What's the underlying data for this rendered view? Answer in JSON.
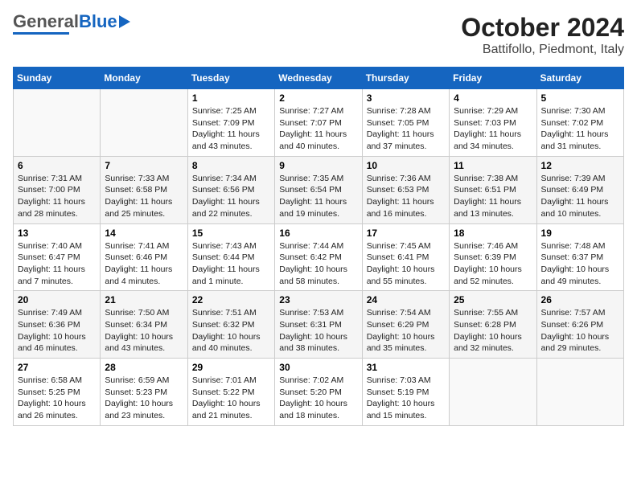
{
  "logo": {
    "text_general": "General",
    "text_blue": "Blue"
  },
  "title": "October 2024",
  "subtitle": "Battifollo, Piedmont, Italy",
  "header_row": [
    "Sunday",
    "Monday",
    "Tuesday",
    "Wednesday",
    "Thursday",
    "Friday",
    "Saturday"
  ],
  "weeks": [
    [
      {
        "day": "",
        "info": ""
      },
      {
        "day": "",
        "info": ""
      },
      {
        "day": "1",
        "info": "Sunrise: 7:25 AM\nSunset: 7:09 PM\nDaylight: 11 hours\nand 43 minutes."
      },
      {
        "day": "2",
        "info": "Sunrise: 7:27 AM\nSunset: 7:07 PM\nDaylight: 11 hours\nand 40 minutes."
      },
      {
        "day": "3",
        "info": "Sunrise: 7:28 AM\nSunset: 7:05 PM\nDaylight: 11 hours\nand 37 minutes."
      },
      {
        "day": "4",
        "info": "Sunrise: 7:29 AM\nSunset: 7:03 PM\nDaylight: 11 hours\nand 34 minutes."
      },
      {
        "day": "5",
        "info": "Sunrise: 7:30 AM\nSunset: 7:02 PM\nDaylight: 11 hours\nand 31 minutes."
      }
    ],
    [
      {
        "day": "6",
        "info": "Sunrise: 7:31 AM\nSunset: 7:00 PM\nDaylight: 11 hours\nand 28 minutes."
      },
      {
        "day": "7",
        "info": "Sunrise: 7:33 AM\nSunset: 6:58 PM\nDaylight: 11 hours\nand 25 minutes."
      },
      {
        "day": "8",
        "info": "Sunrise: 7:34 AM\nSunset: 6:56 PM\nDaylight: 11 hours\nand 22 minutes."
      },
      {
        "day": "9",
        "info": "Sunrise: 7:35 AM\nSunset: 6:54 PM\nDaylight: 11 hours\nand 19 minutes."
      },
      {
        "day": "10",
        "info": "Sunrise: 7:36 AM\nSunset: 6:53 PM\nDaylight: 11 hours\nand 16 minutes."
      },
      {
        "day": "11",
        "info": "Sunrise: 7:38 AM\nSunset: 6:51 PM\nDaylight: 11 hours\nand 13 minutes."
      },
      {
        "day": "12",
        "info": "Sunrise: 7:39 AM\nSunset: 6:49 PM\nDaylight: 11 hours\nand 10 minutes."
      }
    ],
    [
      {
        "day": "13",
        "info": "Sunrise: 7:40 AM\nSunset: 6:47 PM\nDaylight: 11 hours\nand 7 minutes."
      },
      {
        "day": "14",
        "info": "Sunrise: 7:41 AM\nSunset: 6:46 PM\nDaylight: 11 hours\nand 4 minutes."
      },
      {
        "day": "15",
        "info": "Sunrise: 7:43 AM\nSunset: 6:44 PM\nDaylight: 11 hours\nand 1 minute."
      },
      {
        "day": "16",
        "info": "Sunrise: 7:44 AM\nSunset: 6:42 PM\nDaylight: 10 hours\nand 58 minutes."
      },
      {
        "day": "17",
        "info": "Sunrise: 7:45 AM\nSunset: 6:41 PM\nDaylight: 10 hours\nand 55 minutes."
      },
      {
        "day": "18",
        "info": "Sunrise: 7:46 AM\nSunset: 6:39 PM\nDaylight: 10 hours\nand 52 minutes."
      },
      {
        "day": "19",
        "info": "Sunrise: 7:48 AM\nSunset: 6:37 PM\nDaylight: 10 hours\nand 49 minutes."
      }
    ],
    [
      {
        "day": "20",
        "info": "Sunrise: 7:49 AM\nSunset: 6:36 PM\nDaylight: 10 hours\nand 46 minutes."
      },
      {
        "day": "21",
        "info": "Sunrise: 7:50 AM\nSunset: 6:34 PM\nDaylight: 10 hours\nand 43 minutes."
      },
      {
        "day": "22",
        "info": "Sunrise: 7:51 AM\nSunset: 6:32 PM\nDaylight: 10 hours\nand 40 minutes."
      },
      {
        "day": "23",
        "info": "Sunrise: 7:53 AM\nSunset: 6:31 PM\nDaylight: 10 hours\nand 38 minutes."
      },
      {
        "day": "24",
        "info": "Sunrise: 7:54 AM\nSunset: 6:29 PM\nDaylight: 10 hours\nand 35 minutes."
      },
      {
        "day": "25",
        "info": "Sunrise: 7:55 AM\nSunset: 6:28 PM\nDaylight: 10 hours\nand 32 minutes."
      },
      {
        "day": "26",
        "info": "Sunrise: 7:57 AM\nSunset: 6:26 PM\nDaylight: 10 hours\nand 29 minutes."
      }
    ],
    [
      {
        "day": "27",
        "info": "Sunrise: 6:58 AM\nSunset: 5:25 PM\nDaylight: 10 hours\nand 26 minutes."
      },
      {
        "day": "28",
        "info": "Sunrise: 6:59 AM\nSunset: 5:23 PM\nDaylight: 10 hours\nand 23 minutes."
      },
      {
        "day": "29",
        "info": "Sunrise: 7:01 AM\nSunset: 5:22 PM\nDaylight: 10 hours\nand 21 minutes."
      },
      {
        "day": "30",
        "info": "Sunrise: 7:02 AM\nSunset: 5:20 PM\nDaylight: 10 hours\nand 18 minutes."
      },
      {
        "day": "31",
        "info": "Sunrise: 7:03 AM\nSunset: 5:19 PM\nDaylight: 10 hours\nand 15 minutes."
      },
      {
        "day": "",
        "info": ""
      },
      {
        "day": "",
        "info": ""
      }
    ]
  ]
}
